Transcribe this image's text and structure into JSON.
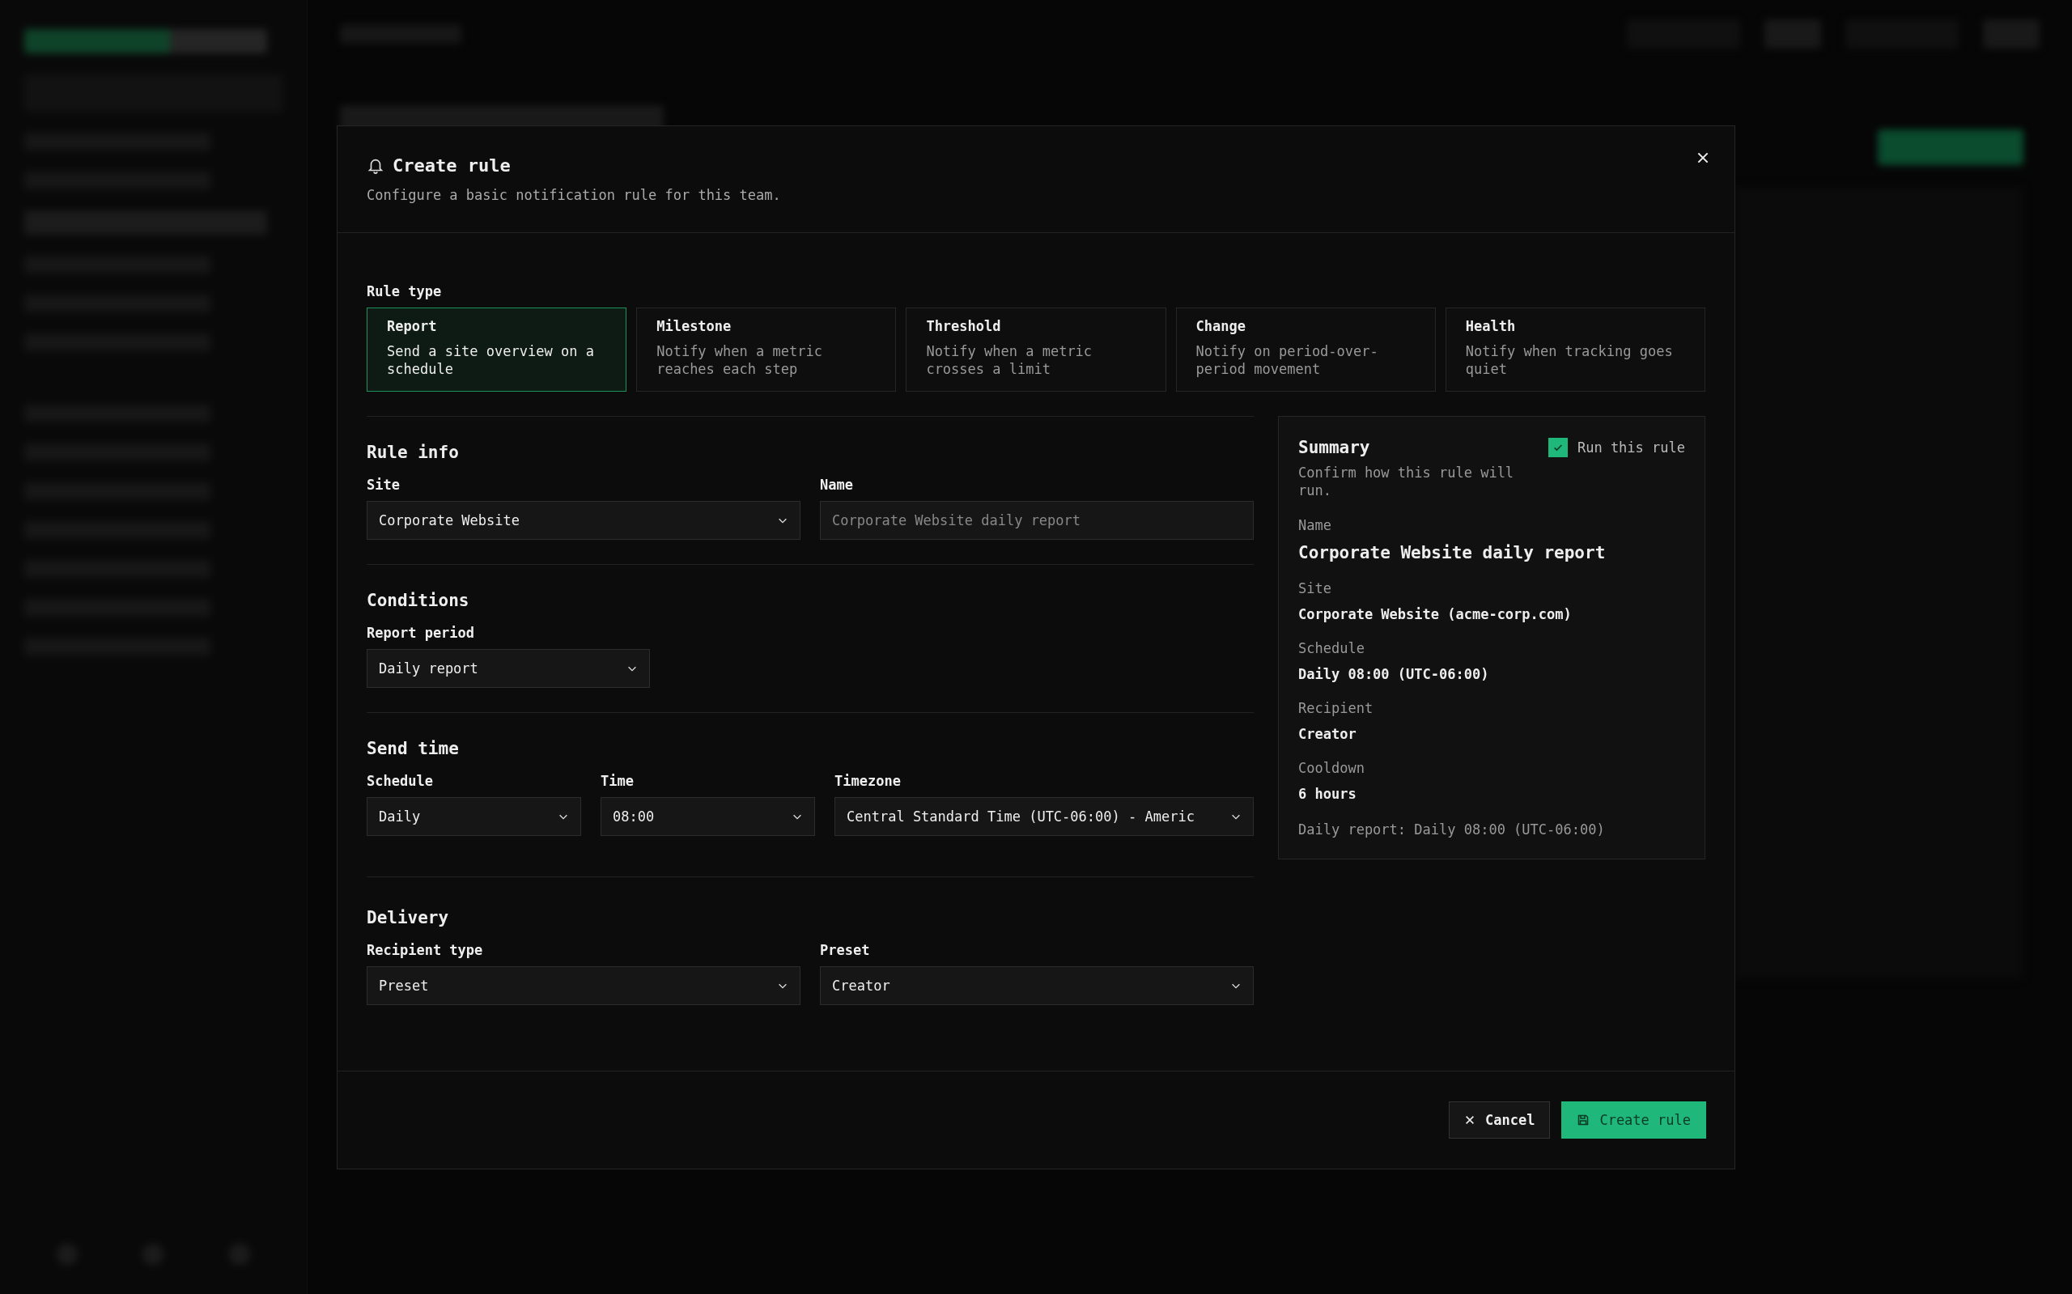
{
  "dialog": {
    "title": "Create rule",
    "subtitle": "Configure a basic notification rule for this team.",
    "rule_type": {
      "label": "Rule type",
      "options": [
        {
          "title": "Report",
          "description": "Send a site overview on a schedule",
          "selected": true
        },
        {
          "title": "Milestone",
          "description": "Notify when a metric reaches each step",
          "selected": false
        },
        {
          "title": "Threshold",
          "description": "Notify when a metric crosses a limit",
          "selected": false
        },
        {
          "title": "Change",
          "description": "Notify on period-over-period movement",
          "selected": false
        },
        {
          "title": "Health",
          "description": "Notify when tracking goes quiet",
          "selected": false
        }
      ]
    },
    "sections": [
      {
        "heading": "Rule info",
        "fields": [
          {
            "label": "Site",
            "kind": "select",
            "value": "Corporate Website"
          },
          {
            "label": "Name",
            "kind": "text",
            "placeholder": "Corporate Website daily report"
          }
        ]
      },
      {
        "heading": "Conditions",
        "fields": [
          {
            "label": "Report period",
            "kind": "select",
            "value": "Daily report"
          }
        ]
      },
      {
        "heading": "Send time",
        "fields": [
          {
            "label": "Schedule",
            "kind": "select",
            "value": "Daily"
          },
          {
            "label": "Time",
            "kind": "select",
            "value": "08:00"
          },
          {
            "label": "Timezone",
            "kind": "select",
            "value": "Central Standard Time (UTC-06:00) - Americ"
          }
        ]
      },
      {
        "heading": "Delivery",
        "fields": [
          {
            "label": "Recipient type",
            "kind": "select",
            "value": "Preset"
          },
          {
            "label": "Preset",
            "kind": "select",
            "value": "Creator"
          }
        ]
      }
    ],
    "summary": {
      "title": "Summary",
      "subtitle": "Confirm how this rule will run.",
      "enabled": {
        "label": "Run this rule",
        "checked": true
      },
      "items": [
        {
          "label": "Name",
          "value": "Corporate Website daily report"
        },
        {
          "label": "Site",
          "value": "Corporate Website (acme-corp.com)"
        },
        {
          "label": "Schedule",
          "value": "Daily 08:00 (UTC-06:00)"
        },
        {
          "label": "Recipient",
          "value": "Creator"
        },
        {
          "label": "Cooldown",
          "value": "6 hours"
        }
      ],
      "footnote": "Daily report: Daily 08:00 (UTC-06:00)"
    },
    "buttons": [
      {
        "label": "Cancel",
        "kind": "secondary"
      },
      {
        "label": "Create rule",
        "kind": "primary"
      }
    ]
  }
}
